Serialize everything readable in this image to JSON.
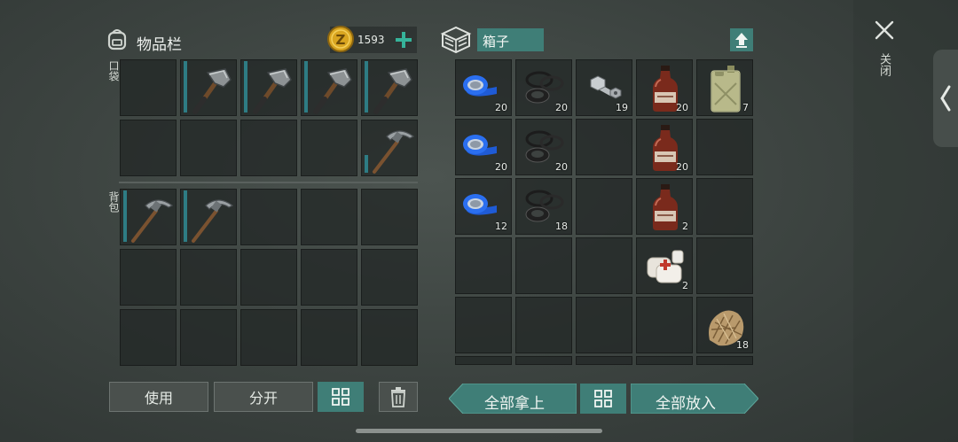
{
  "inventory": {
    "title": "物品栏",
    "currency": "1593",
    "pocket_label": "口袋",
    "backpack_label": "背包",
    "buttons": {
      "use": "使用",
      "split": "分开"
    }
  },
  "box": {
    "title": "箱子",
    "buttons": {
      "take_all": "全部拿上",
      "put_all": "全部放入"
    },
    "counts": {
      "tape_1": "20",
      "seal_1": "20",
      "bolt": "19",
      "bottle_1": "20",
      "gas_can": "7",
      "tape_2": "20",
      "seal_2": "20",
      "bottle_2": "20",
      "tape_3": "12",
      "seal_3": "18",
      "bottle_3": "2",
      "bandage": "2",
      "fiber": "18"
    }
  },
  "close": {
    "label": "关闭"
  },
  "colors": {
    "accent_teal": "#3f7e77",
    "coin_gold": "#d9a520",
    "slot_bg": "#222826"
  },
  "icons": [
    "backpack-icon",
    "coin-icon",
    "plus-icon",
    "crate-icon",
    "upload-icon",
    "close-icon",
    "chevron-left-icon",
    "grid-icon",
    "trash-icon"
  ]
}
